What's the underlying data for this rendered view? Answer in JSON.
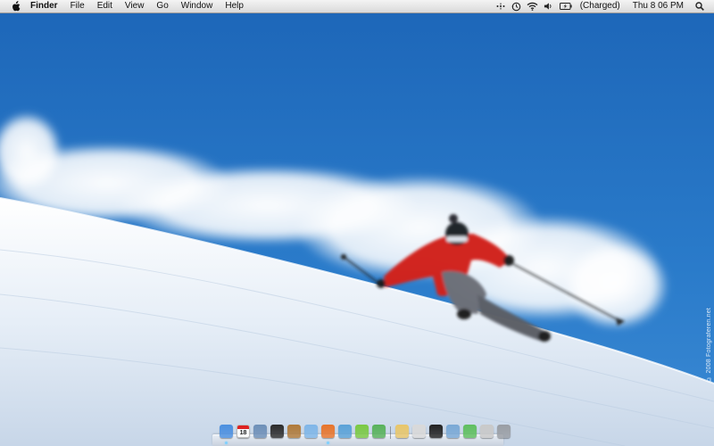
{
  "wallpaper": {
    "description_name": "skier-powder-wallpaper",
    "credit": "© 2008 Fotograferen.net"
  },
  "menubar": {
    "apple_icon": "apple-icon",
    "app_name": "Finder",
    "menus": [
      "File",
      "Edit",
      "View",
      "Go",
      "Window",
      "Help"
    ],
    "status": {
      "bluetooth_icon": "bluetooth-icon",
      "time_machine_icon": "time-machine-icon",
      "wifi_icon": "wifi-icon",
      "volume_icon": "volume-icon",
      "battery_icon": "battery-icon",
      "battery_text": "(Charged)",
      "clock": "Thu 8 06 PM",
      "spotlight_icon": "spotlight-icon"
    }
  },
  "dock": {
    "calendar_day": "18",
    "apps": [
      {
        "name": "finder-icon",
        "color": "#4b8fe0",
        "running": true
      },
      {
        "name": "calendar-icon",
        "color": "#ffffff",
        "running": false
      },
      {
        "name": "preview-icon",
        "color": "#6d8fb8",
        "running": false
      },
      {
        "name": "dvd-icon",
        "color": "#2c2c2c",
        "running": false
      },
      {
        "name": "photo-icon",
        "color": "#b07a3a",
        "running": false
      },
      {
        "name": "itunes-icon",
        "color": "#7fb6e8",
        "running": false
      },
      {
        "name": "firefox-icon",
        "color": "#e8742a",
        "running": true
      },
      {
        "name": "safari-icon",
        "color": "#5aa2d8",
        "running": false
      },
      {
        "name": "green-app-icon",
        "color": "#7ac943",
        "running": false
      },
      {
        "name": "adium-icon",
        "color": "#58b25a",
        "running": false
      },
      {
        "name": "notes-icon",
        "color": "#e8c66a",
        "running": false
      },
      {
        "name": "stickies-icon",
        "color": "#d9d9d9",
        "running": false
      },
      {
        "name": "terminal-icon",
        "color": "#222222",
        "running": false
      },
      {
        "name": "mail-icon",
        "color": "#7aa9d6",
        "running": false
      },
      {
        "name": "download-icon",
        "color": "#5fbf5f",
        "running": false
      },
      {
        "name": "documents-folder-icon",
        "color": "#c9c9c9",
        "running": false
      },
      {
        "name": "trash-icon",
        "color": "#9a9ea4",
        "running": false
      }
    ]
  }
}
